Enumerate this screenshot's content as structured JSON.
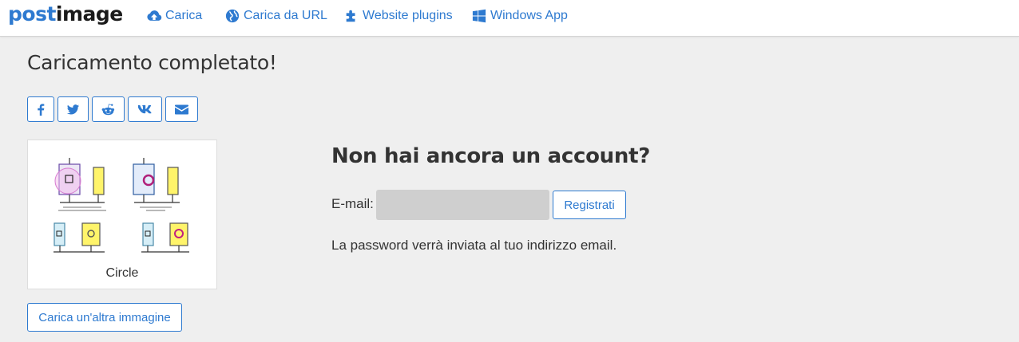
{
  "brand": {
    "part1": "post",
    "part2": "image"
  },
  "nav": {
    "items": [
      {
        "label": "Carica",
        "icon": "cloud-upload-icon"
      },
      {
        "label": "Carica da URL",
        "icon": "globe-icon"
      },
      {
        "label": "Website plugins",
        "icon": "puzzle-icon"
      },
      {
        "label": "Windows App",
        "icon": "windows-icon"
      }
    ]
  },
  "main": {
    "title": "Caricamento completato!",
    "share": [
      "facebook-icon",
      "twitter-icon",
      "reddit-icon",
      "vk-icon",
      "envelope-icon"
    ],
    "thumbnail": {
      "caption": "Circle"
    },
    "upload_another_label": "Carica un'altra immagine"
  },
  "signup": {
    "title": "Non hai ancora un account?",
    "email_label": "E-mail:",
    "email_value": "",
    "register_label": "Registrati",
    "note": "La password verrà inviata al tuo indirizzo email."
  },
  "colors": {
    "accent": "#2e7ad0",
    "background": "#efefef",
    "input_bg": "#cfcfcf"
  }
}
